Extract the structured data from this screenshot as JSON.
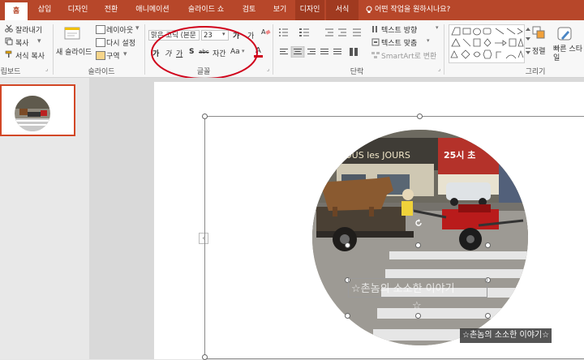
{
  "tabs": [
    {
      "label": "홈"
    },
    {
      "label": "삽입"
    },
    {
      "label": "디자인"
    },
    {
      "label": "전환"
    },
    {
      "label": "애니메이션"
    },
    {
      "label": "슬라이드 쇼"
    },
    {
      "label": "검토"
    },
    {
      "label": "보기"
    },
    {
      "label": "디자인"
    },
    {
      "label": "서식"
    }
  ],
  "tell_me": "어떤 작업을 원하시나요?",
  "clipboard": {
    "cut": "잘라내기",
    "copy": "복사",
    "format_painter": "서식 복사",
    "label": "립보드"
  },
  "slides_group": {
    "new_slide": "새 슬라이드",
    "layout": "레이아웃",
    "reset": "다시 설정",
    "section": "구역",
    "label": "슬라이드"
  },
  "font_group": {
    "font_name": "맑은 고딕 (본문",
    "font_size": "23",
    "label": "글꼴",
    "bold": "가",
    "italic": "가",
    "underline": "가",
    "shadow": "S",
    "strike": "abc",
    "spacing": "자간",
    "case": "Aa"
  },
  "paragraph_group": {
    "text_direction": "텍스트 방향",
    "align_text": "텍스트 맞춤",
    "smartart": "SmartArt로 변환",
    "label": "단락"
  },
  "drawing_group": {
    "arrange": "정렬",
    "quick_styles": "빠른 스타일",
    "label": "그리기"
  },
  "photo": {
    "sign_text": "OUS les JOURS",
    "sign2_text": "25시 초",
    "caption_center": "☆촌놈의 소소한 이야기",
    "caption_star": "☆",
    "watermark": "☆촌놈의 소소한 이야기☆"
  },
  "colors": {
    "accent": "#b7472a",
    "annotation": "#d0021b"
  }
}
